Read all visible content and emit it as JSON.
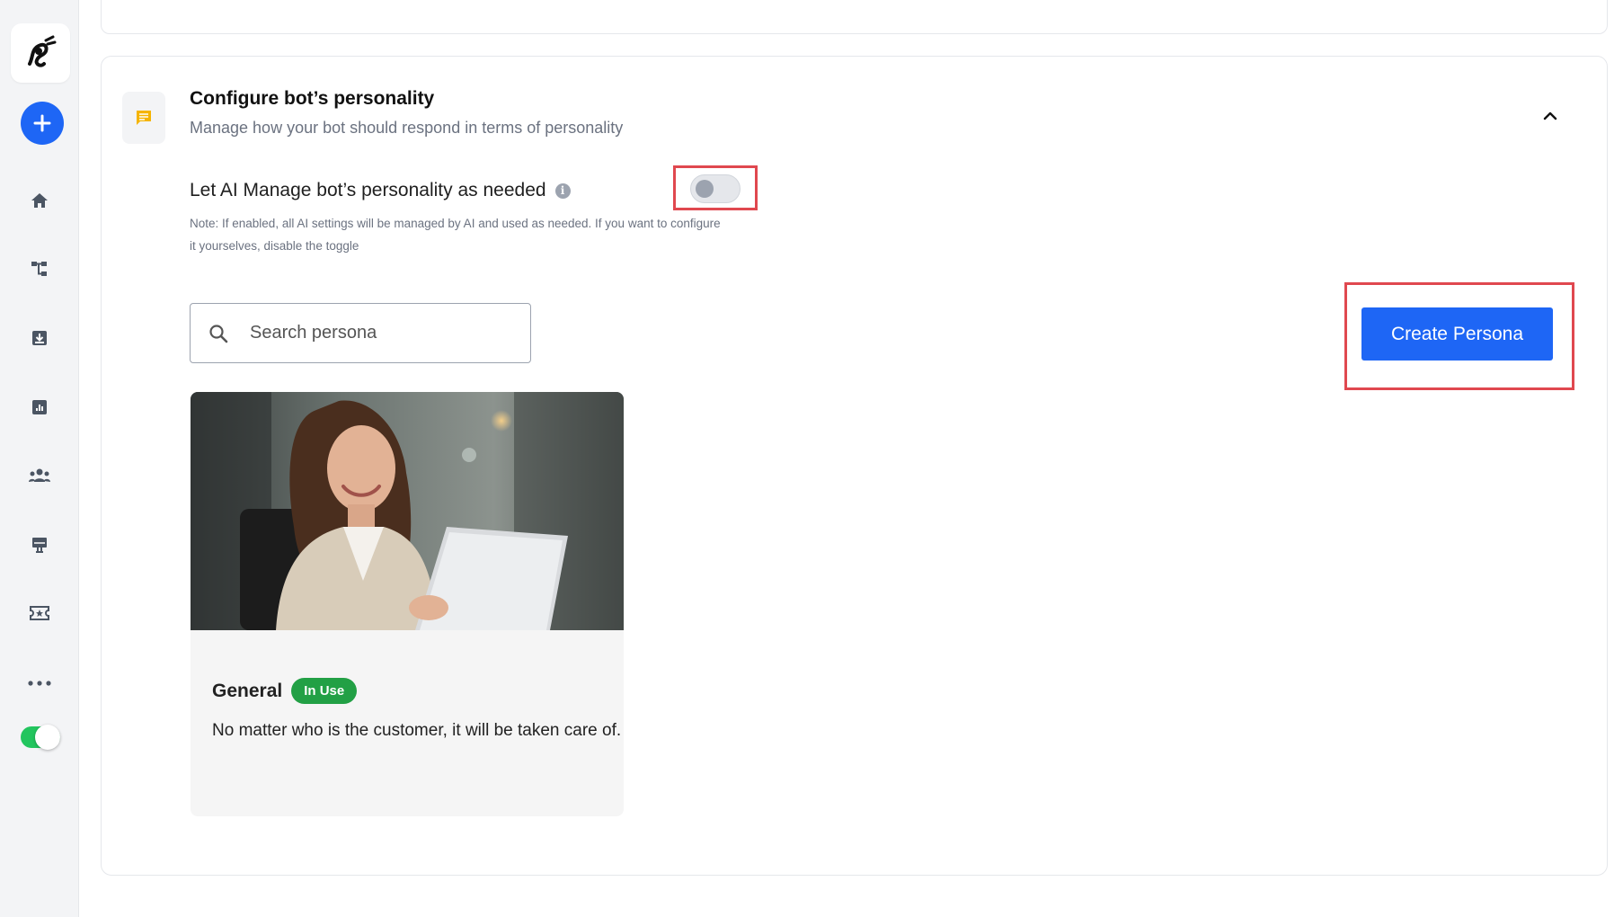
{
  "sidebar": {
    "items": [
      {
        "icon": "home-icon"
      },
      {
        "icon": "flow-icon"
      },
      {
        "icon": "inbox-download-icon"
      },
      {
        "icon": "analytics-icon"
      },
      {
        "icon": "team-icon"
      },
      {
        "icon": "kiosk-icon"
      },
      {
        "icon": "ticket-star-icon"
      },
      {
        "icon": "more-icon"
      }
    ],
    "toggle_on": true
  },
  "section": {
    "title": "Configure bot’s personality",
    "subtitle": "Manage how your bot should respond in terms of personality"
  },
  "ai_manage": {
    "label": "Let AI Manage bot’s personality as needed",
    "info": "i",
    "note": "Note: If enabled, all AI settings will be managed by AI and used as needed. If you want to configure it yourselves, disable the toggle",
    "enabled": false
  },
  "search": {
    "placeholder": "Search persona",
    "value": ""
  },
  "create_button": {
    "label": "Create Persona"
  },
  "personas": [
    {
      "name": "General",
      "badge": "In Use",
      "description": "No matter who is the customer, it will be taken care of."
    }
  ],
  "colors": {
    "accent": "#1e66f5",
    "highlight": "#e0484f",
    "badge": "#22a045",
    "toggle_on": "#22c55e"
  }
}
